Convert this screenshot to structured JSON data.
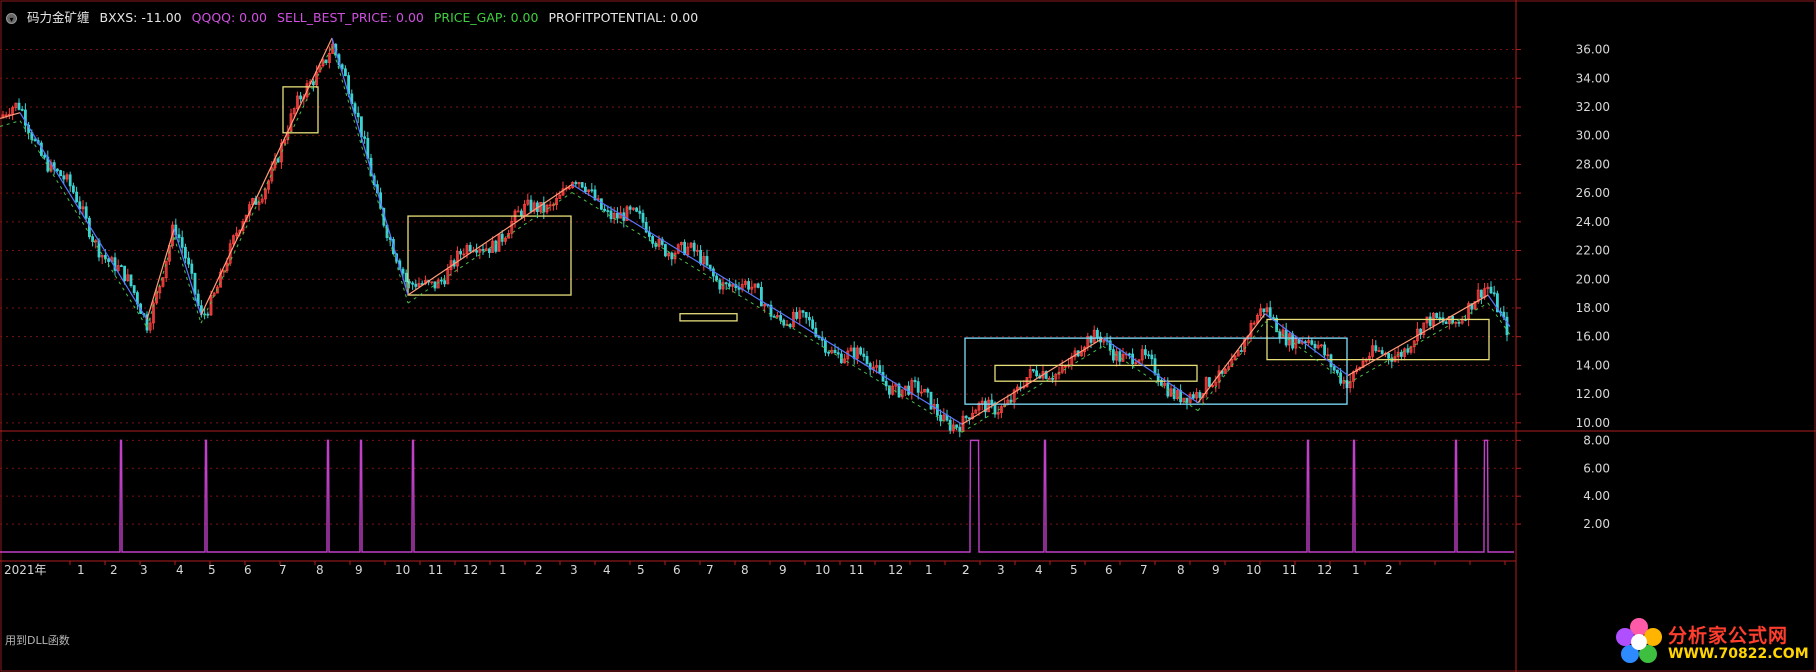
{
  "legend": {
    "title": "码力金矿缠",
    "bxxs": "BXXS: -11.00",
    "qqqq": "QQQQ: 0.00",
    "sell": "SELL_BEST_PRICE: 0.00",
    "gap": "PRICE_GAP: 0.00",
    "profit": "PROFITPOTENTIAL: 0.00"
  },
  "colors": {
    "background": "#000000",
    "up_candle": "#ff4040",
    "down_candle": "#3cd2d2",
    "grid": "#7a1414",
    "axis_text": "#d8d8d8",
    "zigzag_up": "#ff9e7a",
    "zigzag_down": "#5a78ff",
    "box_yellow": "#e8df7a",
    "box_cyan": "#7fe0ff",
    "signal_line": "#c040c8",
    "legend_title": "#e6e6e6",
    "legend_bxxs": "#e6e6e6",
    "legend_qqqq": "#d050e0",
    "legend_sell": "#d050e0",
    "legend_gap": "#40d040",
    "legend_profit": "#e6e6e6"
  },
  "dll_note": "用到DLL函数",
  "logo": {
    "brand": "分析家公式网",
    "url": "WWW.70822.COM"
  },
  "chart_data": [
    {
      "type": "line",
      "title": "",
      "ylim": [
        9.5,
        37.5
      ],
      "y_ticks": [
        "10.00",
        "12.00",
        "14.00",
        "16.00",
        "18.00",
        "20.00",
        "22.00",
        "24.00",
        "26.00",
        "28.00",
        "30.00",
        "32.00",
        "34.00",
        "36.00"
      ],
      "grid": true,
      "x_year_label": "2021年",
      "x_month_labels": [
        "1",
        "2",
        "3",
        "4",
        "5",
        "6",
        "7",
        "8",
        "9",
        "10",
        "11",
        "12",
        "1",
        "2",
        "3",
        "4",
        "5",
        "6",
        "7",
        "8",
        "9",
        "10",
        "11",
        "12",
        "1",
        "2"
      ],
      "zigzag": [
        {
          "x": 0,
          "y": 31.2
        },
        {
          "x": 20,
          "y": 31.6
        },
        {
          "x": 147,
          "y": 17.2
        },
        {
          "x": 174,
          "y": 23.5
        },
        {
          "x": 201,
          "y": 17.5
        },
        {
          "x": 332,
          "y": 36.8
        },
        {
          "x": 408,
          "y": 18.9
        },
        {
          "x": 572,
          "y": 26.6
        },
        {
          "x": 962,
          "y": 9.9
        },
        {
          "x": 1103,
          "y": 15.9
        },
        {
          "x": 1198,
          "y": 11.4
        },
        {
          "x": 1265,
          "y": 17.6
        },
        {
          "x": 1348,
          "y": 13.3
        },
        {
          "x": 1488,
          "y": 18.9
        },
        {
          "x": 1510,
          "y": 16.7
        }
      ],
      "boxes": [
        {
          "x1": 283,
          "x2": 318,
          "y_low": 30.2,
          "y_high": 33.4,
          "color": "yellow"
        },
        {
          "x1": 408,
          "x2": 571,
          "y_low": 18.9,
          "y_high": 24.4,
          "color": "yellow"
        },
        {
          "x1": 680,
          "x2": 737,
          "y_low": 17.1,
          "y_high": 17.6,
          "color": "yellow"
        },
        {
          "x1": 965,
          "x2": 1347,
          "y_low": 11.3,
          "y_high": 15.9,
          "color": "cyan"
        },
        {
          "x1": 995,
          "x2": 1197,
          "y_low": 12.9,
          "y_high": 14.0,
          "color": "yellow"
        },
        {
          "x1": 1267,
          "x2": 1489,
          "y_low": 14.4,
          "y_high": 17.2,
          "color": "yellow"
        }
      ]
    },
    {
      "type": "line",
      "title": "",
      "ylim": [
        0,
        8.6
      ],
      "y_ticks": [
        "2.00",
        "4.00",
        "6.00",
        "8.00"
      ],
      "series": [
        {
          "values_baseline": 0,
          "spikes": [
            {
              "x": 120,
              "w": 2,
              "h": 8
            },
            {
              "x": 205,
              "w": 2,
              "h": 8
            },
            {
              "x": 327,
              "w": 2,
              "h": 8
            },
            {
              "x": 360,
              "w": 2,
              "h": 8
            },
            {
              "x": 412,
              "w": 2,
              "h": 8
            },
            {
              "x": 970,
              "w": 9,
              "h": 8
            },
            {
              "x": 1044,
              "w": 2,
              "h": 8
            },
            {
              "x": 1307,
              "w": 2,
              "h": 8
            },
            {
              "x": 1353,
              "w": 2,
              "h": 8
            },
            {
              "x": 1455,
              "w": 2,
              "h": 8
            },
            {
              "x": 1484,
              "w": 4,
              "h": 8
            }
          ]
        }
      ]
    }
  ]
}
